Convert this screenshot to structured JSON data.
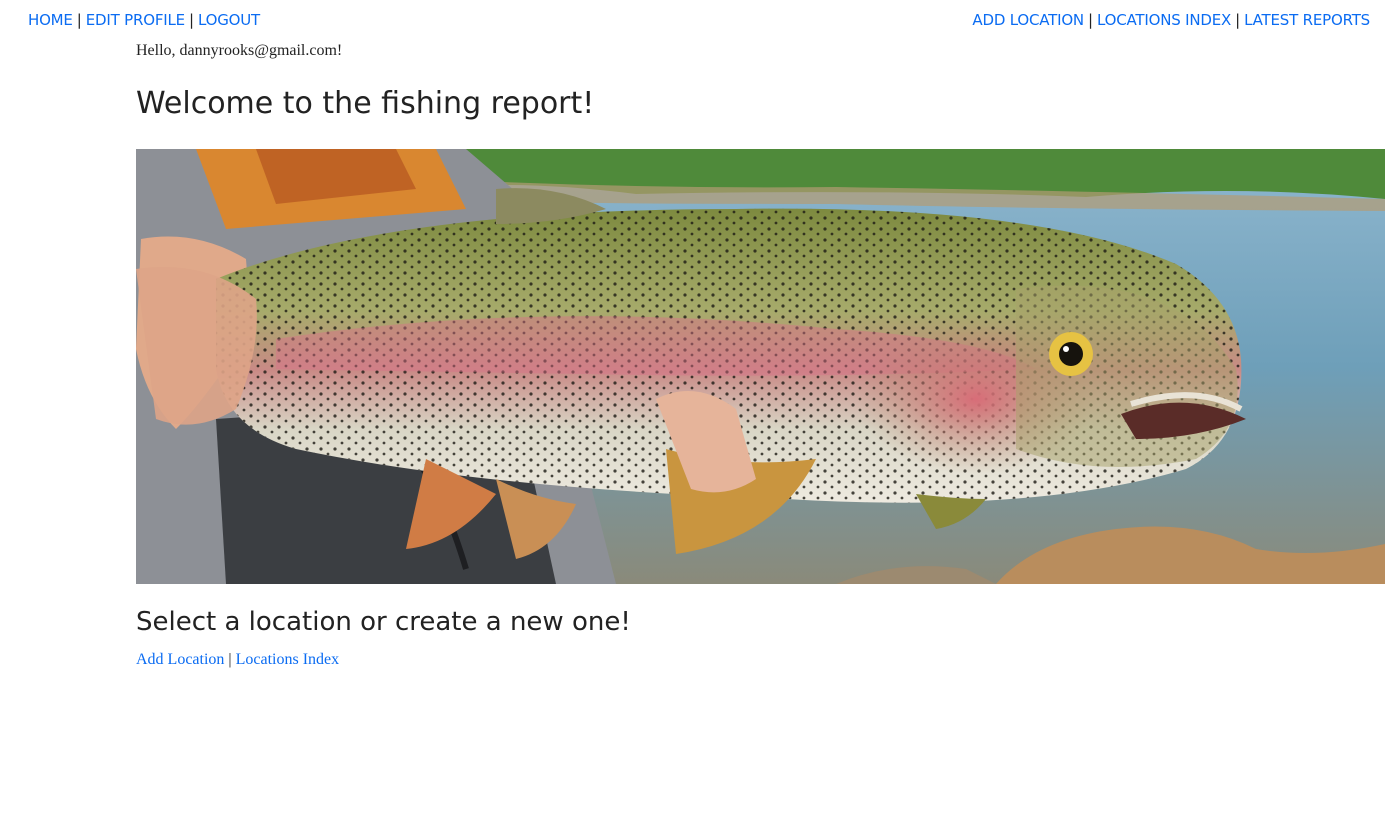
{
  "nav": {
    "left": [
      {
        "label": "HOME"
      },
      {
        "label": "EDIT PROFILE"
      },
      {
        "label": "LOGOUT"
      }
    ],
    "right": [
      {
        "label": "ADD LOCATION"
      },
      {
        "label": "LOCATIONS INDEX"
      },
      {
        "label": "LATEST REPORTS"
      }
    ],
    "separator": "|"
  },
  "greeting": "Hello, dannyrooks@gmail.com!",
  "title": "Welcome to the fishing report!",
  "hero": {
    "subject": "rainbow-trout-photo"
  },
  "subtitle": "Select a location or create a new one!",
  "links": {
    "add_location": "Add Location",
    "locations_index": "Locations Index",
    "separator": "|"
  },
  "colors": {
    "link": "#0b6cf2",
    "text": "#222222",
    "background": "#ffffff"
  }
}
